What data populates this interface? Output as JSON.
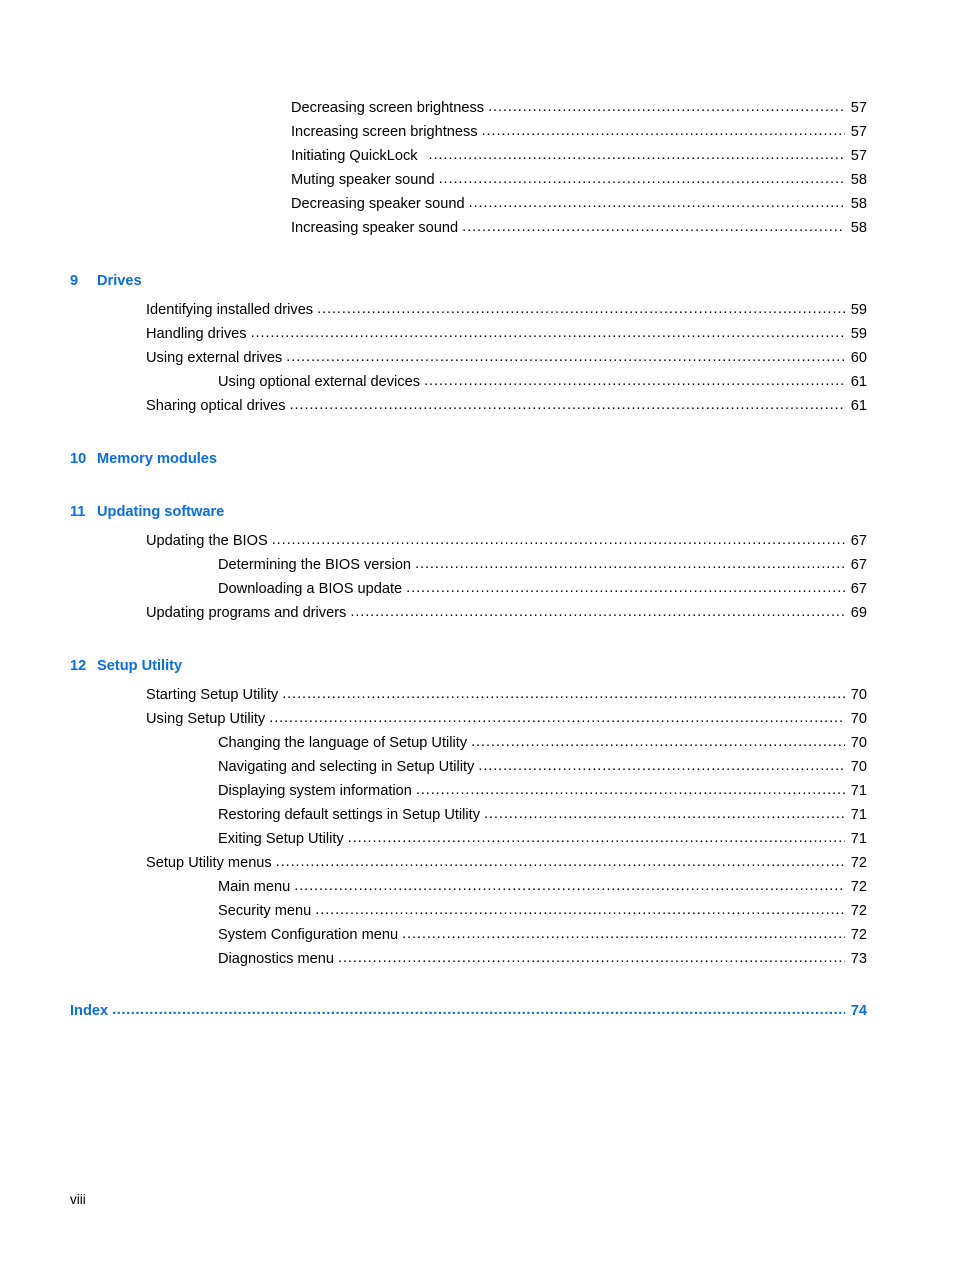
{
  "document": {
    "kind": "table-of-contents",
    "footer_page_label": "viii",
    "accent_color": "#0b6ce8",
    "text_color": "#000000",
    "background_color": "#ffffff",
    "leader_char": "."
  },
  "blocks": [
    {
      "type": "entries",
      "entries": [
        {
          "label": "Decreasing screen brightness",
          "page": "57",
          "level": 3,
          "extra_gap": false
        },
        {
          "label": "Increasing screen brightness",
          "page": "57",
          "level": 3,
          "extra_gap": false
        },
        {
          "label": "Initiating QuickLock",
          "page": "57",
          "level": 3,
          "extra_gap": true
        },
        {
          "label": "Muting speaker sound",
          "page": "58",
          "level": 3,
          "extra_gap": false
        },
        {
          "label": "Decreasing speaker sound",
          "page": "58",
          "level": 3,
          "extra_gap": false
        },
        {
          "label": "Increasing speaker sound",
          "page": "58",
          "level": 3,
          "extra_gap": false
        }
      ]
    },
    {
      "type": "chapter",
      "number": "9",
      "title": "Drives",
      "entries": [
        {
          "label": "Identifying installed drives",
          "page": "59",
          "level": 1,
          "extra_gap": false
        },
        {
          "label": "Handling drives",
          "page": "59",
          "level": 1,
          "extra_gap": false
        },
        {
          "label": "Using external drives",
          "page": "60",
          "level": 1,
          "extra_gap": false
        },
        {
          "label": "Using optional external devices",
          "page": "61",
          "level": 2,
          "extra_gap": false
        },
        {
          "label": "Sharing optical drives",
          "page": "61",
          "level": 1,
          "extra_gap": false
        }
      ]
    },
    {
      "type": "chapter",
      "number": "10",
      "title": "Memory modules",
      "entries": []
    },
    {
      "type": "chapter",
      "number": "11",
      "title": "Updating software",
      "entries": [
        {
          "label": "Updating the BIOS",
          "page": "67",
          "level": 1,
          "extra_gap": false
        },
        {
          "label": "Determining the BIOS version",
          "page": "67",
          "level": 2,
          "extra_gap": false
        },
        {
          "label": "Downloading a BIOS update",
          "page": "67",
          "level": 2,
          "extra_gap": false
        },
        {
          "label": "Updating programs and drivers",
          "page": "69",
          "level": 1,
          "extra_gap": false
        }
      ]
    },
    {
      "type": "chapter",
      "number": "12",
      "title": "Setup Utility",
      "entries": [
        {
          "label": "Starting Setup Utility",
          "page": "70",
          "level": 1,
          "extra_gap": false
        },
        {
          "label": "Using Setup Utility",
          "page": "70",
          "level": 1,
          "extra_gap": false
        },
        {
          "label": "Changing the language of Setup Utility",
          "page": "70",
          "level": 2,
          "extra_gap": false
        },
        {
          "label": "Navigating and selecting in Setup Utility",
          "page": "70",
          "level": 2,
          "extra_gap": false
        },
        {
          "label": "Displaying system information",
          "page": "71",
          "level": 2,
          "extra_gap": false
        },
        {
          "label": "Restoring default settings in Setup Utility",
          "page": "71",
          "level": 2,
          "extra_gap": false
        },
        {
          "label": "Exiting Setup Utility",
          "page": "71",
          "level": 2,
          "extra_gap": false
        },
        {
          "label": "Setup Utility menus",
          "page": "72",
          "level": 1,
          "extra_gap": false
        },
        {
          "label": "Main menu",
          "page": "72",
          "level": 2,
          "extra_gap": false
        },
        {
          "label": "Security menu",
          "page": "72",
          "level": 2,
          "extra_gap": false
        },
        {
          "label": "System Configuration menu",
          "page": "72",
          "level": 2,
          "extra_gap": false
        },
        {
          "label": "Diagnostics menu",
          "page": "73",
          "level": 2,
          "extra_gap": false
        }
      ]
    }
  ],
  "index_entry": {
    "label": "Index",
    "page": "74"
  }
}
